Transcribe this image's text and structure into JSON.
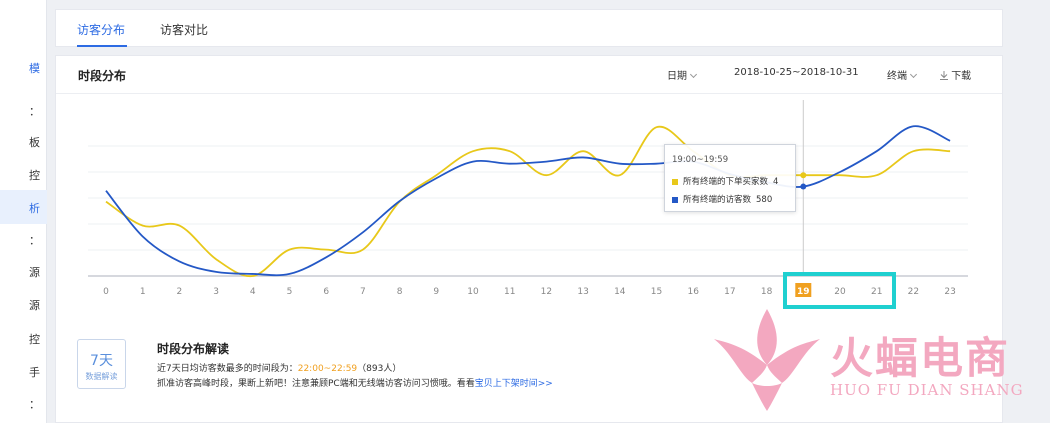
{
  "sidebar": {
    "items": [
      "模",
      "：",
      "板",
      "控",
      "析",
      "：",
      "源",
      "源",
      "控",
      "手",
      "："
    ],
    "active_index": 4
  },
  "tabs": [
    {
      "label": "访客分布",
      "active": true
    },
    {
      "label": "访客对比",
      "active": false
    }
  ],
  "panel": {
    "title": "时段分布",
    "date_label": "日期",
    "date_range": "2018-10-25~2018-10-31",
    "terminal_label": "终端",
    "download_label": "下载",
    "download_icon": "download-icon"
  },
  "tooltip": {
    "title": "19:00~19:59",
    "rows": [
      {
        "label": "所有终端的下单买家数",
        "value": "4",
        "color": "#e8c81a"
      },
      {
        "label": "所有终端的访客数",
        "value": "580",
        "color": "#2458c6"
      }
    ]
  },
  "chart_data": {
    "type": "line",
    "x": [
      "0",
      "1",
      "2",
      "3",
      "4",
      "5",
      "6",
      "7",
      "8",
      "9",
      "10",
      "11",
      "12",
      "13",
      "14",
      "15",
      "16",
      "17",
      "18",
      "19",
      "20",
      "21",
      "22",
      "23"
    ],
    "highlighted_x": "19",
    "series": [
      {
        "name": "所有终端的下单买家数",
        "color": "#e8c81a",
        "values": [
          3.1,
          2.1,
          2.1,
          0.7,
          0.0,
          1.1,
          1.1,
          1.1,
          3.1,
          4.2,
          5.2,
          5.2,
          4.2,
          5.2,
          4.2,
          6.2,
          5.2,
          4.2,
          4.2,
          4.2,
          4.2,
          4.2,
          5.2,
          5.2
        ]
      },
      {
        "name": "所有终端的访客数",
        "color": "#2458c6",
        "values": [
          560,
          340,
          220,
          170,
          160,
          160,
          240,
          360,
          510,
          620,
          700,
          690,
          700,
          720,
          690,
          690,
          700,
          640,
          600,
          580,
          650,
          750,
          870,
          800
        ]
      }
    ],
    "y_left_range": [
      0,
      6.5
    ],
    "y_right_range": [
      150,
      900
    ],
    "grid": true,
    "legend": "tooltip"
  },
  "summary": {
    "icon_big": "7天",
    "icon_small": "数据解读",
    "title": "时段分布解读",
    "line1_prefix": "近7天日均访客数最多的时间段为：",
    "line1_highlight": "22:00~22:59",
    "line1_suffix": "（893人）",
    "line2_text": "抓准访客高峰时段，果断上新吧！注意兼顾PC端和无线端访客访问习惯哦。看看",
    "line2_link": "宝贝上下架时间>>"
  },
  "watermark": {
    "text_cn": "火蝠电商",
    "text_en": "HUO FU DIAN SHANG"
  }
}
